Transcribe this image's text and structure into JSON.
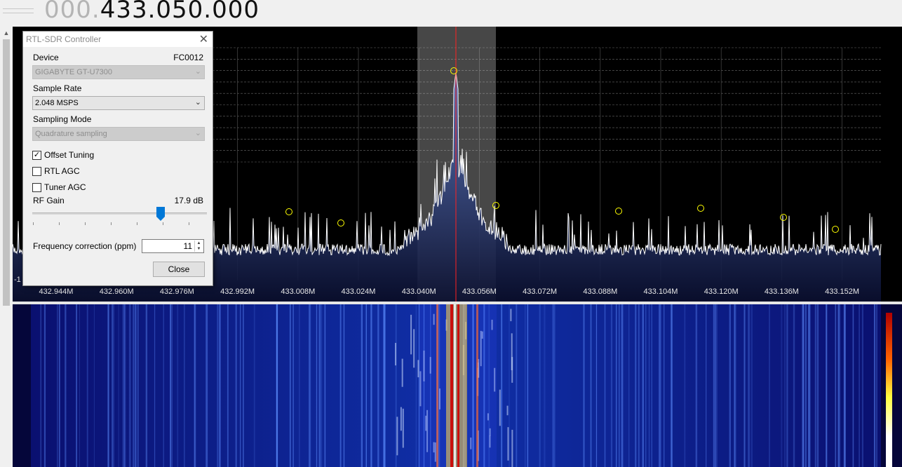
{
  "frequency": {
    "dim_part": "000.",
    "main_part": "433.050.000"
  },
  "spectrum": {
    "axis_labels": [
      "432.944M",
      "432.960M",
      "432.976M",
      "432.992M",
      "433.008M",
      "433.024M",
      "433.040M",
      "433.056M",
      "433.072M",
      "433.088M",
      "433.104M",
      "433.120M",
      "433.136M",
      "433.152M"
    ],
    "left_axis_label": "-1",
    "peak_color": "#ffff00",
    "center_line_color": "#ff2020",
    "trace_color": "#ffffff"
  },
  "dialog": {
    "title": "RTL-SDR Controller",
    "device_label": "Device",
    "device_code": "FC0012",
    "device_value": "GIGABYTE GT-U7300",
    "sample_rate_label": "Sample Rate",
    "sample_rate_value": "2.048 MSPS",
    "sampling_mode_label": "Sampling Mode",
    "sampling_mode_value": "Quadrature sampling",
    "offset_tuning_label": "Offset Tuning",
    "offset_tuning_checked": true,
    "rtl_agc_label": "RTL AGC",
    "rtl_agc_checked": false,
    "tuner_agc_label": "Tuner AGC",
    "tuner_agc_checked": false,
    "rf_gain_label": "RF Gain",
    "rf_gain_value": "17.9 dB",
    "freq_correction_label": "Frequency correction (ppm)",
    "freq_correction_value": "11",
    "close_label": "Close"
  }
}
